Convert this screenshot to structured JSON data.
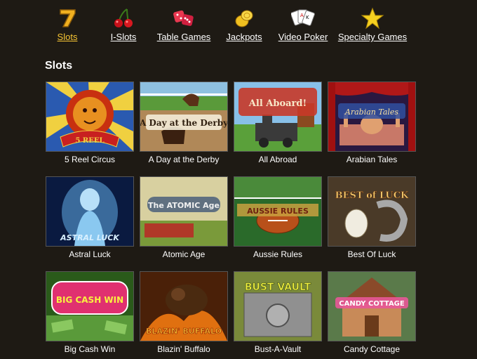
{
  "nav": {
    "items": [
      {
        "label": "Slots",
        "icon": "seven-icon",
        "active": true
      },
      {
        "label": "I-Slots",
        "icon": "cherries-icon",
        "active": false
      },
      {
        "label": "Table Games",
        "icon": "dice-icon",
        "active": false
      },
      {
        "label": "Jackpots",
        "icon": "coins-icon",
        "active": false
      },
      {
        "label": "Video Poker",
        "icon": "cards-icon",
        "active": false
      },
      {
        "label": "Specialty Games",
        "icon": "star-icon",
        "active": false
      }
    ]
  },
  "section": {
    "title": "Slots"
  },
  "games": [
    {
      "name": "5 Reel Circus",
      "art": "lion",
      "logo": "5 REEL"
    },
    {
      "name": "A Day at the Derby",
      "art": "derby",
      "logo": "A Day at the Derby"
    },
    {
      "name": "All Abroad",
      "art": "train",
      "logo": "All Aboard!"
    },
    {
      "name": "Arabian Tales",
      "art": "palace",
      "logo": "Arabian Tales"
    },
    {
      "name": "Astral Luck",
      "art": "astral",
      "logo": "ASTRAL LUCK"
    },
    {
      "name": "Atomic Age",
      "art": "atomic",
      "logo": "The ATOMIC Age"
    },
    {
      "name": "Aussie Rules",
      "art": "football",
      "logo": "AUSSIE RULES"
    },
    {
      "name": "Best Of Luck",
      "art": "horseshoe",
      "logo": "BEST of LUCK"
    },
    {
      "name": "Big Cash Win",
      "art": "cash",
      "logo": "BIG CASH WIN"
    },
    {
      "name": "Blazin' Buffalo",
      "art": "buffalo",
      "logo": "BLAZIN' BUFFALO"
    },
    {
      "name": "Bust-A-Vault",
      "art": "vault",
      "logo": "BUST VAULT"
    },
    {
      "name": "Candy Cottage",
      "art": "candy",
      "logo": "CANDY COTTAGE"
    }
  ],
  "colors": {
    "background": "#1e1a14",
    "active_nav": "#f7c534",
    "text": "#ffffff"
  }
}
